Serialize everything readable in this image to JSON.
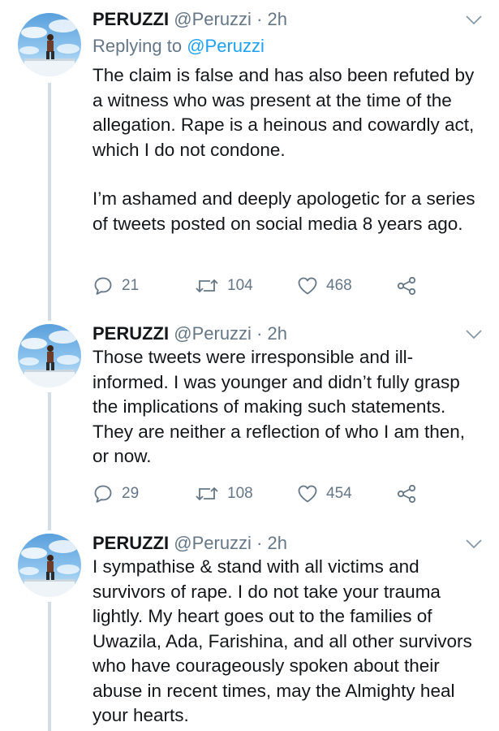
{
  "tweets": [
    {
      "name": "PERUZZI",
      "handle": "@Peruzzi",
      "dot": "·",
      "time": "2h",
      "reply_prefix": "Replying to",
      "reply_handle": "@Peruzzi",
      "paragraphs": [
        "The claim is false and has also been refuted by a witness who was present at the time of the allegation. Rape is a heinous and cowardly act, which I do not condone.",
        "I’m ashamed and deeply apologetic for a series of tweets posted on social media 8 years ago."
      ],
      "replies": "21",
      "retweets": "104",
      "likes": "468"
    },
    {
      "name": "PERUZZI",
      "handle": "@Peruzzi",
      "dot": "·",
      "time": "2h",
      "paragraphs": [
        "Those tweets were irresponsible and ill-informed. I was younger and didn’t fully grasp the implications of making such statements. They are neither a reflection of who I am then, or now."
      ],
      "replies": "29",
      "retweets": "108",
      "likes": "454"
    },
    {
      "name": "PERUZZI",
      "handle": "@Peruzzi",
      "dot": "·",
      "time": "2h",
      "paragraphs": [
        "I sympathise & stand with all victims and survivors of rape. I do not take your trauma lightly. My heart goes out to the families of Uwazila, Ada, Farishina, and all other survivors who have courageously spoken about their abuse in recent times, may the Almighty heal your hearts."
      ]
    }
  ],
  "icons": {
    "reply": "speech-bubble-icon",
    "retweet": "retweet-arrows-icon",
    "like": "heart-icon",
    "share": "share-nodes-icon",
    "menu": "chevron-down-icon"
  },
  "colors": {
    "text": "#14171a",
    "muted": "#657786",
    "link": "#1da1f2",
    "thread_line": "#d3dde6"
  }
}
